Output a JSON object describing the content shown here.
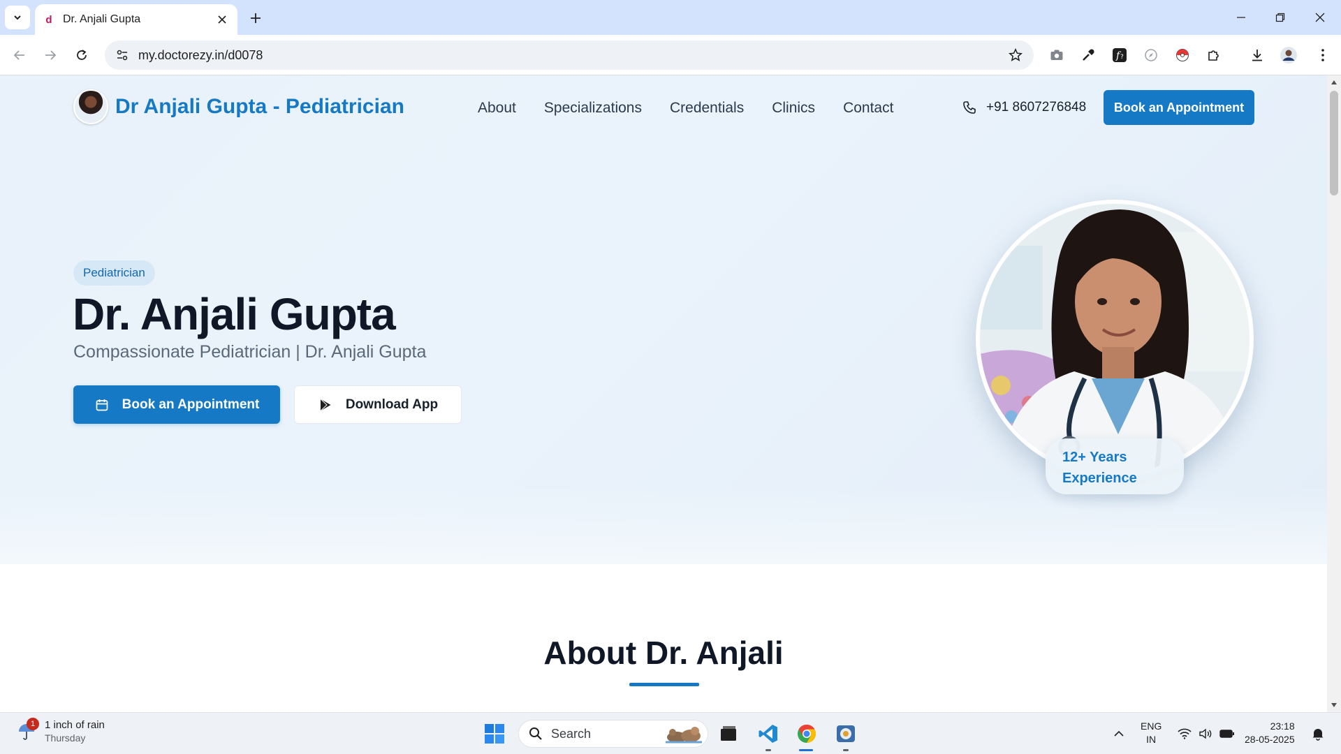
{
  "browser": {
    "tab_title": "Dr. Anjali Gupta",
    "tab_favicon": "d",
    "url": "my.doctorezy.in/d0078"
  },
  "site": {
    "brand_name": "Dr Anjali Gupta - Pediatrician",
    "nav": [
      "About",
      "Specializations",
      "Credentials",
      "Clinics",
      "Contact"
    ],
    "phone": "+91 8607276848",
    "nav_cta": "Book an Appointment"
  },
  "hero": {
    "badge": "Pediatrician",
    "title": "Dr. Anjali Gupta",
    "subtitle": "Compassionate Pediatrician | Dr. Anjali Gupta",
    "primary_button": "Book an Appointment",
    "secondary_button": "Download App",
    "experience_line1": "12+ Years",
    "experience_line2": "Experience"
  },
  "about": {
    "title": "About Dr. Anjali"
  },
  "taskbar": {
    "weather_main": "1 inch of rain",
    "weather_sub": "Thursday",
    "weather_badge": "1",
    "search_label": "Search",
    "lang_line1": "ENG",
    "lang_line2": "IN",
    "time": "23:18",
    "date": "28-05-2025"
  },
  "colors": {
    "brand_blue": "#1679c5",
    "hero_bg": "#e9f2fa",
    "title_dark": "#101827"
  }
}
